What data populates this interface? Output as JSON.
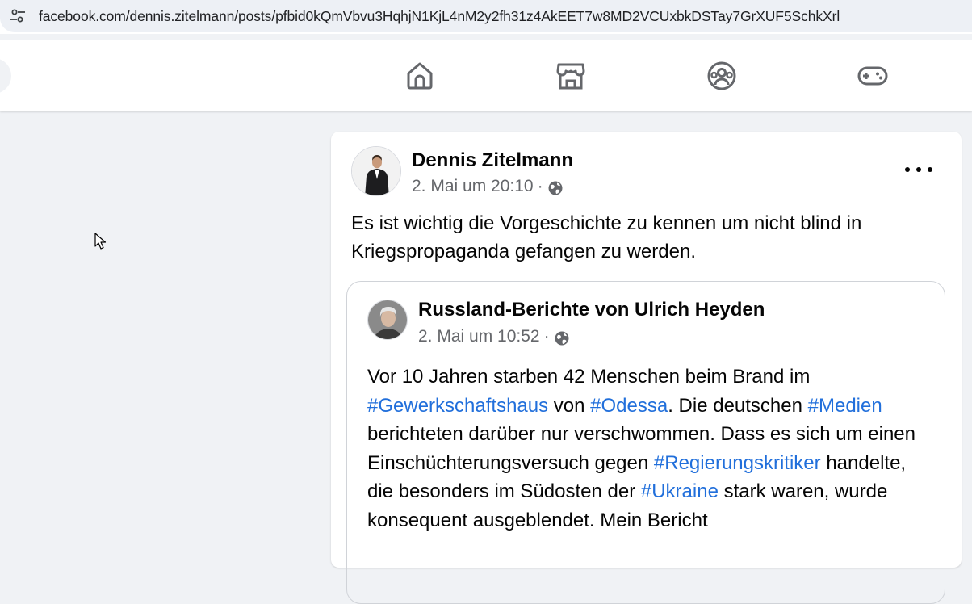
{
  "browser": {
    "url": "facebook.com/dennis.zitelmann/posts/pfbid0kQmVbvu3HqhjN1KjL4nM2y2fh31z4AkEET7w8MD2VCUxbkDSTay7GrXUF5SchkXrl"
  },
  "nav": {
    "icons": [
      "home-icon",
      "marketplace-icon",
      "groups-icon",
      "gaming-icon"
    ]
  },
  "post": {
    "author": "Dennis Zitelmann",
    "timestamp": "2. Mai um 20:10",
    "separator": "·",
    "text": "Es ist wichtig die Vorgeschichte zu kennen um nicht blind in Kriegspropaganda gefangen zu werden."
  },
  "shared_post": {
    "author": "Russland-Berichte von Ulrich Heyden",
    "timestamp": "2. Mai um 10:52",
    "separator": "·",
    "text_parts": [
      "Vor 10 Jahren starben 42 Menschen beim Brand im ",
      "#Gewerkschaftshaus",
      " von ",
      "#Odessa",
      ". Die deutschen ",
      "#Medien",
      " berichteten darüber nur verschwommen. Dass es sich um einen Einschüchterungsversuch gegen ",
      "#Regierungskritiker",
      " handelte, die besonders im Südosten der ",
      "#Ukraine",
      " stark waren, wurde konsequent ausgeblendet. Mein Bericht"
    ]
  },
  "colors": {
    "hashtag": "#216fdb",
    "secondary_text": "#65676b",
    "page_background": "#f0f2f5"
  }
}
